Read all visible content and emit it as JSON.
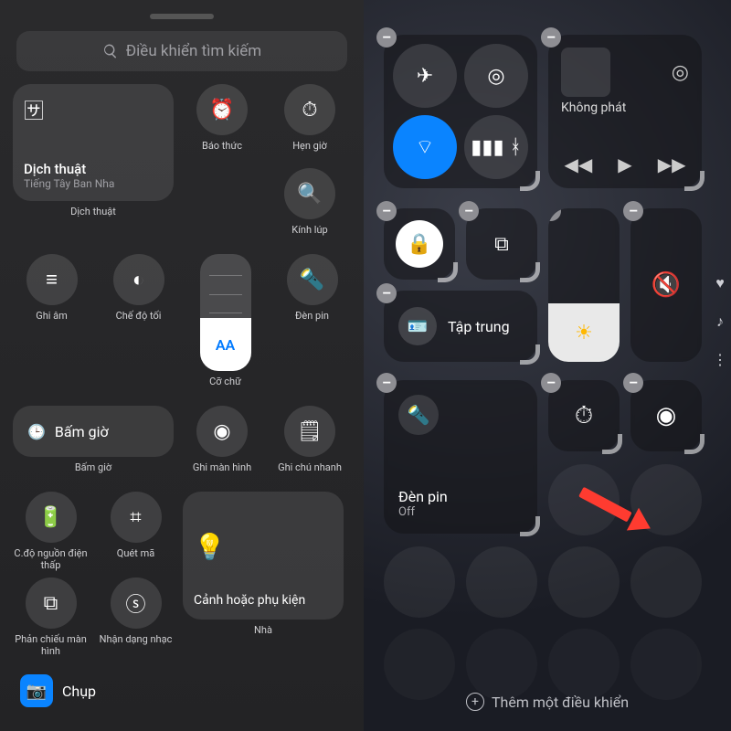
{
  "left": {
    "search_placeholder": "Điều khiển tìm kiếm",
    "translate": {
      "title": "Dịch thuật",
      "subtitle": "Tiếng Tây Ban Nha",
      "label": "Dịch thuật"
    },
    "alarm": "Báo thức",
    "timer": "Hẹn giờ",
    "magnifier": "Kính lúp",
    "voice_memo": "Ghi âm",
    "dark_mode": "Chế độ tối",
    "text_size": "Cỡ chữ",
    "text_size_marker": "AA",
    "flashlight": "Đèn pin",
    "stopwatch": "Bấm giờ",
    "stopwatch_label": "Bấm giờ",
    "screen_record": "Ghi màn hình",
    "quick_note": "Ghi chú nhanh",
    "low_power": "C.độ nguồn điện thấp",
    "scan_code": "Quét mã",
    "home_tile": "Cảnh hoặc phụ kiện",
    "home_label": "Nhà",
    "screen_mirror": "Phản chiếu màn hình",
    "music_recognition": "Nhận dạng nhạc",
    "capture": "Chụp"
  },
  "right": {
    "now_playing": "Không phát",
    "focus": "Tập trung",
    "flashlight_title": "Đèn pin",
    "flashlight_state": "Off",
    "add_control": "Thêm một điều khiển",
    "remove_glyph": "–"
  }
}
